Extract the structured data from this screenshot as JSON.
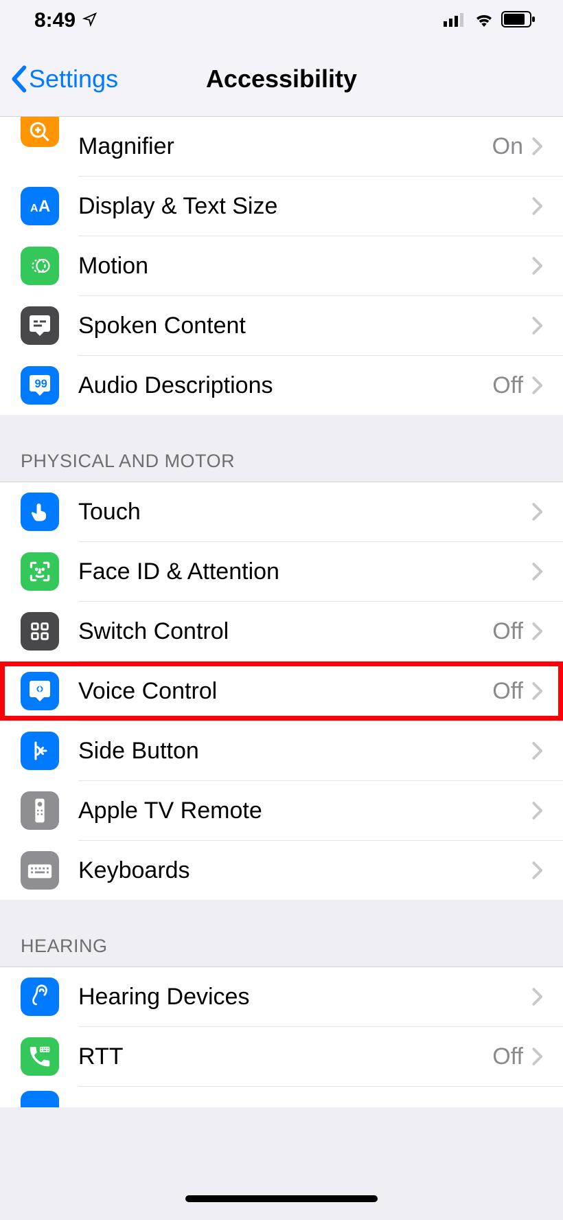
{
  "status": {
    "time": "8:49"
  },
  "nav": {
    "back": "Settings",
    "title": "Accessibility"
  },
  "sections": [
    {
      "header": null,
      "items": [
        {
          "id": "magnifier",
          "label": "Magnifier",
          "value": "On"
        },
        {
          "id": "display-text-size",
          "label": "Display & Text Size",
          "value": ""
        },
        {
          "id": "motion",
          "label": "Motion",
          "value": ""
        },
        {
          "id": "spoken-content",
          "label": "Spoken Content",
          "value": ""
        },
        {
          "id": "audio-descriptions",
          "label": "Audio Descriptions",
          "value": "Off"
        }
      ]
    },
    {
      "header": "PHYSICAL AND MOTOR",
      "items": [
        {
          "id": "touch",
          "label": "Touch",
          "value": ""
        },
        {
          "id": "face-id-attention",
          "label": "Face ID & Attention",
          "value": ""
        },
        {
          "id": "switch-control",
          "label": "Switch Control",
          "value": "Off"
        },
        {
          "id": "voice-control",
          "label": "Voice Control",
          "value": "Off",
          "highlighted": true
        },
        {
          "id": "side-button",
          "label": "Side Button",
          "value": ""
        },
        {
          "id": "apple-tv-remote",
          "label": "Apple TV Remote",
          "value": ""
        },
        {
          "id": "keyboards",
          "label": "Keyboards",
          "value": ""
        }
      ]
    },
    {
      "header": "HEARING",
      "items": [
        {
          "id": "hearing-devices",
          "label": "Hearing Devices",
          "value": ""
        },
        {
          "id": "rtt",
          "label": "RTT",
          "value": "Off"
        }
      ]
    }
  ]
}
